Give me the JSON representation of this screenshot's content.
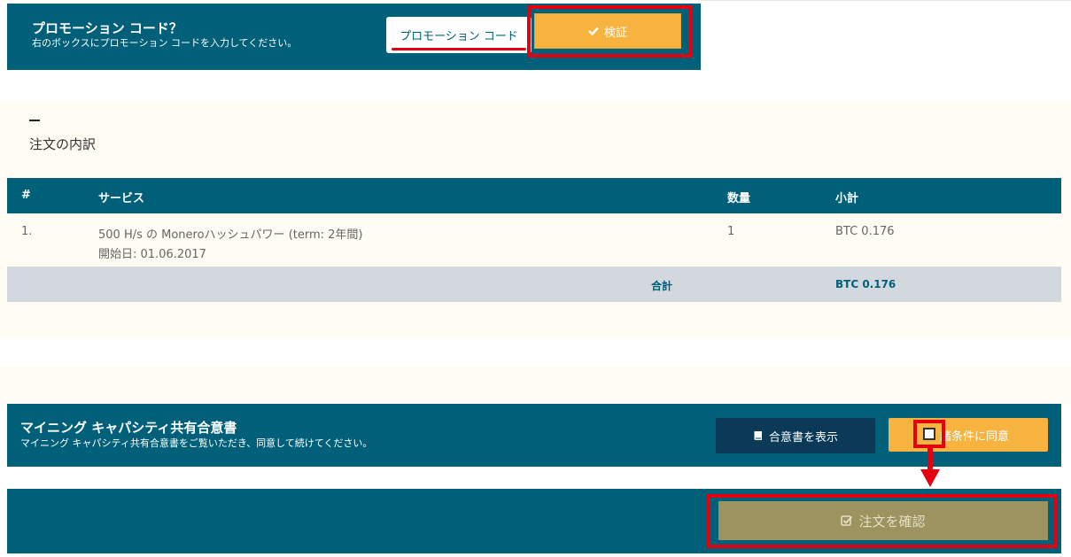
{
  "promo": {
    "title": "プロモーション コード？",
    "subtitle": "右のボックスにプロモーション コードを入力してください。",
    "input_placeholder": "プロモーション コード",
    "verify_label": "検証"
  },
  "order": {
    "dash": "–",
    "title": "注文の内訳",
    "headers": {
      "num": "#",
      "service": "サービス",
      "qty": "数量",
      "subtotal": "小計"
    },
    "rows": [
      {
        "num": "1.",
        "service": "500  H/s の Moneroハッシュパワー (term: 2年間)",
        "start": "開始日: 01.06.2017",
        "qty": "1",
        "subtotal": "BTC 0.176"
      }
    ],
    "total_label": "合計",
    "total_value": "BTC 0.176"
  },
  "agreement": {
    "title": "マイニング キャパシティ共有合意書",
    "subtitle": "マイニング キャパシティ共有合意書をご覧いただき、同意して続けてください。",
    "view_label": "合意書を表示",
    "accept_label": "諸条件に同意"
  },
  "confirm": {
    "label": "注文を確認"
  },
  "icons": {
    "verify": "check-icon",
    "view": "book-icon",
    "confirm": "check-square-icon"
  },
  "colors": {
    "teal": "#00607a",
    "orange": "#f6b340",
    "navy": "#0b3a59",
    "highlight": "#e3000f",
    "disabled": "#9c9360"
  }
}
